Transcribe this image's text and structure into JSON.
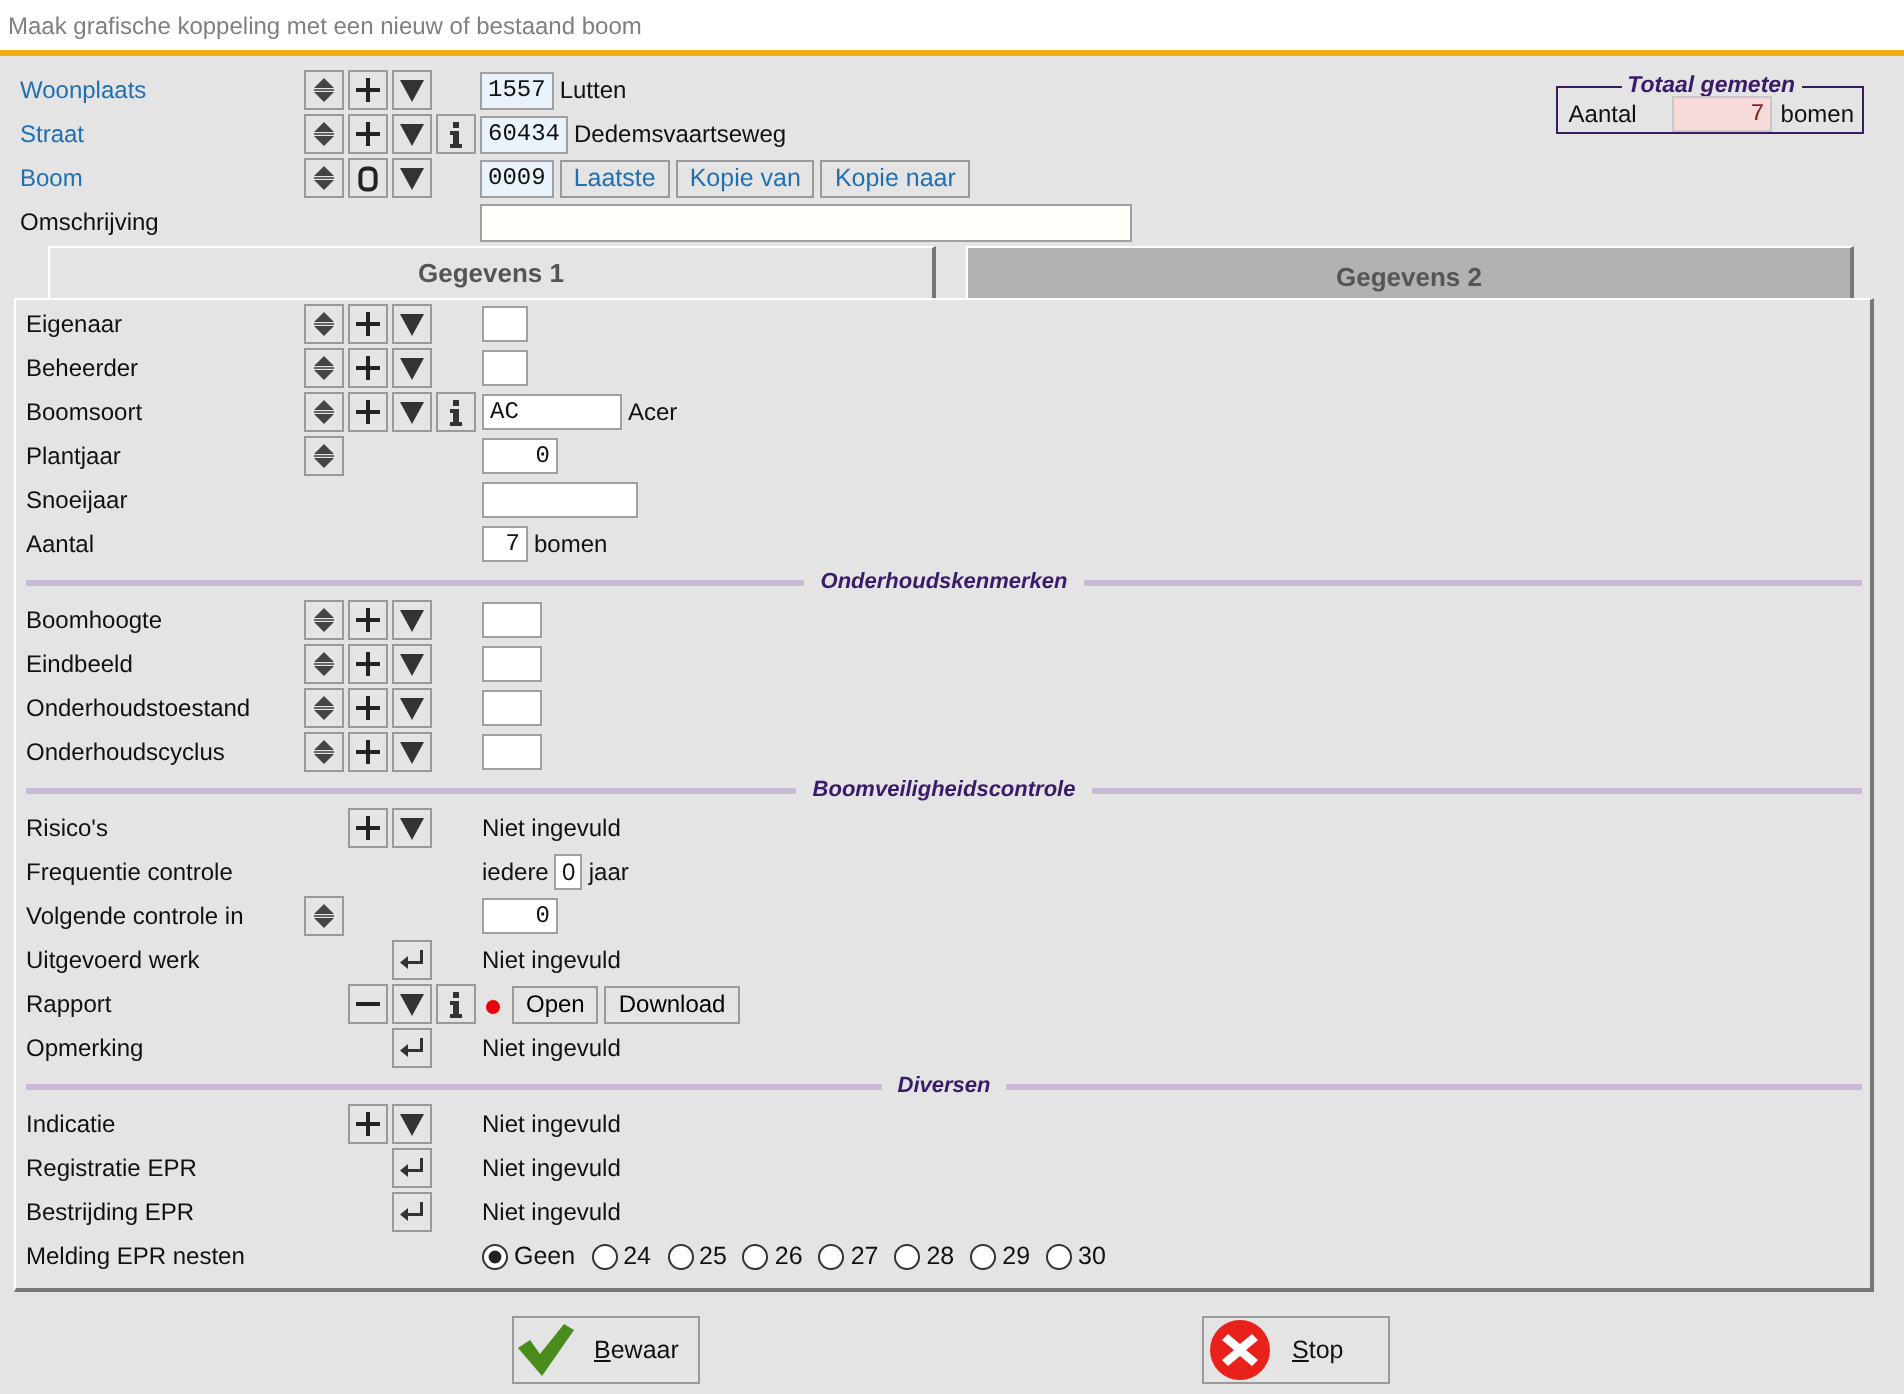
{
  "window": {
    "title": "Maak grafische koppeling met een nieuw of bestaand boom"
  },
  "header_rows": [
    {
      "label": "Woonplaats",
      "kind": "link",
      "tools": [
        {
          "kind": "spin"
        },
        {
          "kind": "plus"
        },
        {
          "kind": "down"
        }
      ],
      "content": [
        {
          "kind": "code-field",
          "value": "1557"
        },
        {
          "kind": "text",
          "text": "Lutten"
        }
      ]
    },
    {
      "label": "Straat",
      "kind": "link",
      "tools": [
        {
          "kind": "spin"
        },
        {
          "kind": "plus"
        },
        {
          "kind": "down"
        },
        {
          "kind": "info"
        }
      ],
      "content": [
        {
          "kind": "code-field",
          "value": "60434"
        },
        {
          "kind": "text",
          "text": "Dedemsvaartseweg"
        }
      ]
    },
    {
      "label": "Boom",
      "kind": "link",
      "tools": [
        {
          "kind": "spin"
        },
        {
          "kind": "zero"
        },
        {
          "kind": "down"
        }
      ],
      "content": [
        {
          "kind": "code-field",
          "value": "0009"
        },
        {
          "kind": "button",
          "label": "Laatste"
        },
        {
          "kind": "button",
          "label": "Kopie van"
        },
        {
          "kind": "button",
          "label": "Kopie naar"
        }
      ]
    },
    {
      "label": "Omschrijving",
      "kind": "plain",
      "content": [
        {
          "kind": "wide-field"
        }
      ]
    }
  ],
  "total": {
    "title": "Totaal gemeten",
    "label": "Aantal",
    "value": "7",
    "unit": "bomen"
  },
  "tabs": [
    {
      "label": "Gegevens 1",
      "selected": true
    },
    {
      "label": "Gegevens 2",
      "selected": false
    }
  ],
  "groups": [
    {
      "rows": [
        {
          "label": "Eigenaar",
          "tools": [
            {
              "kind": "spin"
            },
            {
              "kind": "plus"
            },
            {
              "kind": "down"
            }
          ],
          "content": [
            {
              "kind": "short-field"
            }
          ]
        },
        {
          "label": "Beheerder",
          "tools": [
            {
              "kind": "spin"
            },
            {
              "kind": "plus"
            },
            {
              "kind": "down"
            }
          ],
          "content": [
            {
              "kind": "short-field"
            }
          ]
        },
        {
          "label": "Boomsoort",
          "tools": [
            {
              "kind": "spin"
            },
            {
              "kind": "plus"
            },
            {
              "kind": "down"
            },
            {
              "kind": "info"
            }
          ],
          "content": [
            {
              "kind": "text-field",
              "value": "AC"
            },
            {
              "kind": "text",
              "text": "Acer"
            }
          ]
        },
        {
          "label": "Plantjaar",
          "tools": [
            {
              "kind": "spin"
            }
          ],
          "content": [
            {
              "kind": "number-field",
              "value": "0"
            }
          ]
        },
        {
          "label": "Snoeijaar",
          "content": [
            {
              "kind": "year-field"
            }
          ]
        },
        {
          "label": "Aantal",
          "content": [
            {
              "kind": "short-field",
              "value": "7"
            },
            {
              "kind": "text",
              "text": "bomen"
            }
          ]
        }
      ]
    },
    {
      "title": "Onderhoudskenmerken",
      "rows": [
        {
          "label": "Boomhoogte",
          "tools": [
            {
              "kind": "spin"
            },
            {
              "kind": "plus"
            },
            {
              "kind": "down"
            }
          ],
          "content": [
            {
              "kind": "number-field"
            }
          ]
        },
        {
          "label": "Eindbeeld",
          "tools": [
            {
              "kind": "spin"
            },
            {
              "kind": "plus"
            },
            {
              "kind": "down"
            }
          ],
          "content": [
            {
              "kind": "number-field"
            }
          ]
        },
        {
          "label": "Onderhoudstoestand",
          "tools": [
            {
              "kind": "spin"
            },
            {
              "kind": "plus"
            },
            {
              "kind": "down"
            }
          ],
          "content": [
            {
              "kind": "number-field"
            }
          ]
        },
        {
          "label": "Onderhoudscyclus",
          "tools": [
            {
              "kind": "spin"
            },
            {
              "kind": "plus"
            },
            {
              "kind": "down"
            }
          ],
          "content": [
            {
              "kind": "number-field"
            }
          ]
        }
      ]
    },
    {
      "title": "Boomveiligheidscontrole",
      "rows": [
        {
          "label": "Risico's",
          "tools": [
            {
              "kind": "plus"
            },
            {
              "kind": "down"
            }
          ],
          "content": [
            {
              "kind": "text",
              "text": "Niet ingevuld"
            }
          ]
        },
        {
          "label": "Frequentie controle",
          "content": [
            {
              "kind": "text",
              "text": "iedere"
            },
            {
              "kind": "tiny-field",
              "value": "0"
            },
            {
              "kind": "text",
              "text": "jaar"
            }
          ]
        },
        {
          "label": "Volgende controle in",
          "tools": [
            {
              "kind": "spin"
            }
          ],
          "content": [
            {
              "kind": "number-field",
              "value": "0"
            }
          ]
        },
        {
          "label": "Uitgevoerd werk",
          "tools": [
            {
              "kind": "enter"
            }
          ],
          "content": [
            {
              "kind": "text",
              "text": "Niet ingevuld"
            }
          ]
        },
        {
          "label": "Rapport",
          "tools": [
            {
              "kind": "minus"
            },
            {
              "kind": "down"
            },
            {
              "kind": "info"
            }
          ],
          "content": [
            {
              "kind": "dot",
              "color": "#e8000b"
            },
            {
              "kind": "button",
              "label": "Open"
            },
            {
              "kind": "button",
              "label": "Download"
            }
          ]
        },
        {
          "label": "Opmerking",
          "tools": [
            {
              "kind": "enter"
            }
          ],
          "content": [
            {
              "kind": "text",
              "text": "Niet ingevuld"
            }
          ]
        }
      ]
    },
    {
      "title": "Diversen",
      "rows": [
        {
          "label": "Indicatie",
          "tools": [
            {
              "kind": "plus"
            },
            {
              "kind": "down"
            }
          ],
          "content": [
            {
              "kind": "text",
              "text": "Niet ingevuld"
            }
          ]
        },
        {
          "label": "Registratie EPR",
          "tools": [
            {
              "kind": "enter"
            }
          ],
          "content": [
            {
              "kind": "text",
              "text": "Niet ingevuld"
            }
          ]
        },
        {
          "label": "Bestrijding EPR",
          "tools": [
            {
              "kind": "enter"
            }
          ],
          "content": [
            {
              "kind": "text",
              "text": "Niet ingevuld"
            }
          ]
        },
        {
          "label": "Melding EPR nesten",
          "content": [
            {
              "kind": "radio",
              "label": "Geen",
              "selected": true
            },
            {
              "kind": "radio",
              "label": "24",
              "selected": false
            },
            {
              "kind": "radio",
              "label": "25",
              "selected": false
            },
            {
              "kind": "radio",
              "label": "26",
              "selected": false
            },
            {
              "kind": "radio",
              "label": "27",
              "selected": false
            },
            {
              "kind": "radio",
              "label": "28",
              "selected": false
            },
            {
              "kind": "radio",
              "label": "29",
              "selected": false
            },
            {
              "kind": "radio",
              "label": "30",
              "selected": false
            }
          ]
        }
      ]
    }
  ],
  "buttons": [
    {
      "kind": "save",
      "label": "Bewaar"
    },
    {
      "kind": "stop",
      "label": "Stop"
    }
  ]
}
